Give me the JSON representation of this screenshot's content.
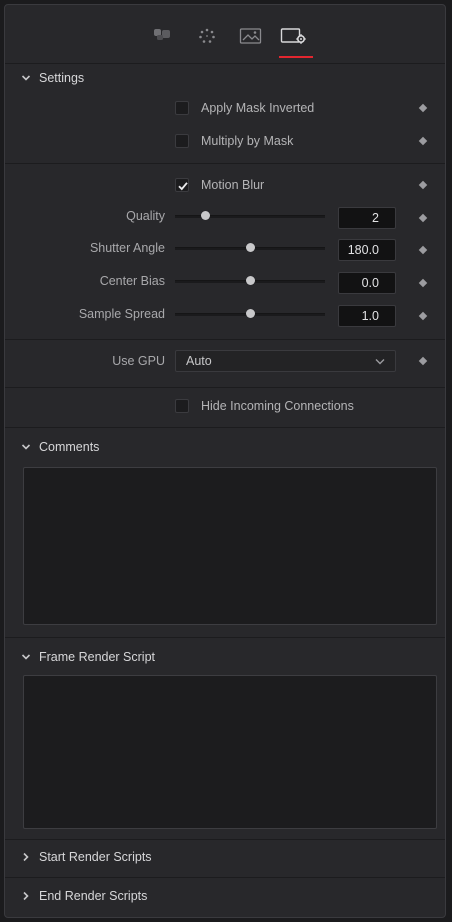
{
  "tabs": [
    {
      "icon": "color-adjust-icon",
      "active": false
    },
    {
      "icon": "particles-icon",
      "active": false
    },
    {
      "icon": "image-icon",
      "active": false
    },
    {
      "icon": "settings-icon",
      "active": true
    }
  ],
  "accent_color": "#e2262f",
  "settings": {
    "title": "Settings",
    "apply_mask_inverted": {
      "label": "Apply Mask Inverted",
      "checked": false
    },
    "multiply_by_mask": {
      "label": "Multiply by Mask",
      "checked": false
    },
    "motion_blur": {
      "label": "Motion Blur",
      "checked": true
    },
    "quality": {
      "label": "Quality",
      "value": "2",
      "slider_fraction": 0.2
    },
    "shutter_angle": {
      "label": "Shutter Angle",
      "value": "180.0",
      "slider_fraction": 0.5
    },
    "center_bias": {
      "label": "Center Bias",
      "value": "0.0",
      "slider_fraction": 0.5
    },
    "sample_spread": {
      "label": "Sample Spread",
      "value": "1.0",
      "slider_fraction": 0.5
    },
    "use_gpu": {
      "label": "Use GPU",
      "value": "Auto"
    },
    "hide_incoming": {
      "label": "Hide Incoming Connections",
      "checked": false
    }
  },
  "comments": {
    "title": "Comments",
    "text": ""
  },
  "frame_render_script": {
    "title": "Frame Render Script",
    "text": ""
  },
  "start_render_scripts": {
    "title": "Start Render Scripts"
  },
  "end_render_scripts": {
    "title": "End Render Scripts"
  }
}
